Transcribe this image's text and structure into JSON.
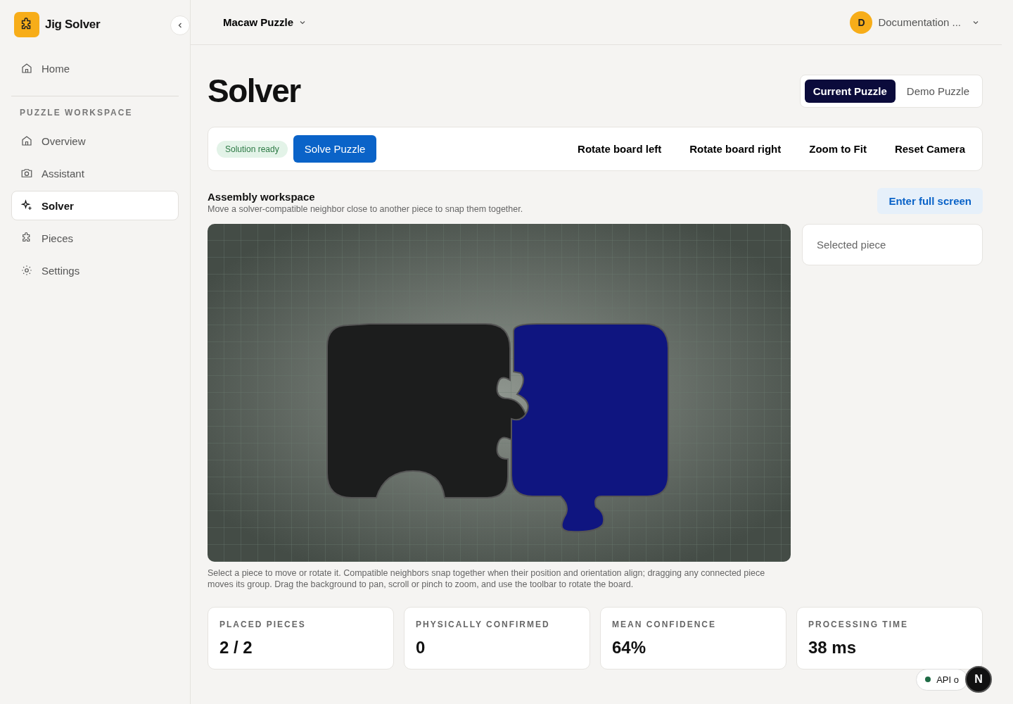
{
  "brand": {
    "name": "Jig Solver"
  },
  "sidebar": {
    "top_items": [
      {
        "label": "Home",
        "selected": false
      }
    ],
    "section_title": "PUZZLE WORKSPACE",
    "items": [
      {
        "label": "Overview",
        "selected": false
      },
      {
        "label": "Assistant",
        "selected": false
      },
      {
        "label": "Solver",
        "selected": true
      },
      {
        "label": "Pieces",
        "selected": false
      },
      {
        "label": "Settings",
        "selected": false
      }
    ]
  },
  "header": {
    "project": "Macaw Puzzle",
    "avatar": "D",
    "account": "Documentation ..."
  },
  "page_title": "Solver",
  "puzzle_toggle": [
    {
      "label": "Current Puzzle",
      "selected": true
    },
    {
      "label": "Demo Puzzle",
      "selected": false
    }
  ],
  "toolbar": {
    "status": "Solution ready",
    "solve": "Solve Puzzle",
    "actions": [
      "Rotate board left",
      "Rotate board right",
      "Zoom to Fit",
      "Reset Camera"
    ]
  },
  "workspace": {
    "title": "Assembly workspace",
    "subtitle": "Move a solver-compatible neighbor close to another piece to snap them together.",
    "fullscreen": "Enter full screen",
    "selected_piece": "Selected piece",
    "help": "Select a piece to move or rotate it. Compatible neighbors snap together when their position and orientation align; dragging any connected piece moves its group. Drag the background to pan, scroll or pinch to zoom, and use the toolbar to rotate the board."
  },
  "stats": [
    {
      "label": "PLACED PIECES",
      "value": "2 / 2"
    },
    {
      "label": "PHYSICALLY CONFIRMED",
      "value": "0"
    },
    {
      "label": "MEAN CONFIDENCE",
      "value": "64%"
    },
    {
      "label": "PROCESSING TIME",
      "value": "38 ms"
    }
  ],
  "api_status": {
    "text": "API o",
    "color": "#1e6b45"
  },
  "dev_badge": "N"
}
